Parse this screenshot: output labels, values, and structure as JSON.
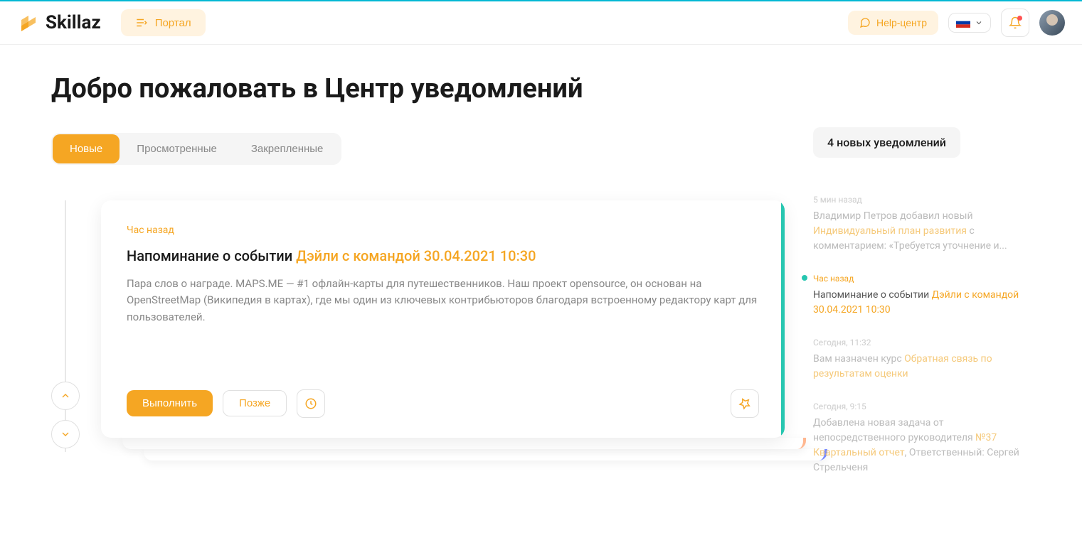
{
  "brand": "Skillaz",
  "header": {
    "portal_label": "Портал",
    "help_label": "Help-центр"
  },
  "page_title": "Добро пожаловать в Центр уведомлений",
  "tabs": [
    {
      "label": "Новые",
      "active": true
    },
    {
      "label": "Просмотренные",
      "active": false
    },
    {
      "label": "Закрепленные",
      "active": false
    }
  ],
  "card": {
    "time": "Час назад",
    "title_prefix": "Напоминание о событии ",
    "title_highlight": "Дэйли с командой 30.04.2021 10:30",
    "body": "Пара слов о награде. MAPS.ME — #1 офлайн-карты для путешественников. Наш проект opensource, он основан на OpenStreetMap (Википедия в картах), где мы один из ключевых контрибьюторов благодаря встроенному редактору карт для пользователей.",
    "action_primary": "Выполнить",
    "action_secondary": "Позже"
  },
  "badge_text": "4 новых уведомлений",
  "sidebar": [
    {
      "time": "5 мин назад",
      "dim": true,
      "parts": [
        {
          "t": "Владимир Петров добавил новый "
        },
        {
          "t": "Индивидуальный план развития",
          "link": true
        },
        {
          "t": " с комментарием: «Требуется уточнение и..."
        }
      ]
    },
    {
      "time": "Час назад",
      "active": true,
      "parts": [
        {
          "t": "Напоминание о событии "
        },
        {
          "t": "Дэйли с командой 30.04.2021 10:30",
          "link": true
        }
      ]
    },
    {
      "time": "Сегодня, 11:32",
      "dim": true,
      "parts": [
        {
          "t": "Вам назначен курс "
        },
        {
          "t": "Обратная связь по результатам оценки",
          "link": true
        }
      ]
    },
    {
      "time": "Сегодня, 9:15",
      "dim": true,
      "parts": [
        {
          "t": "Добавлена новая задача от непосредственного руководителя "
        },
        {
          "t": "№37 Квартальный отчет",
          "link": true
        },
        {
          "t": ", Ответственный: Сергей Стрельченя"
        }
      ]
    }
  ]
}
